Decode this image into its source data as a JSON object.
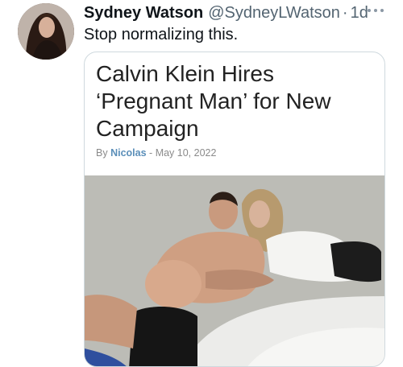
{
  "tweet": {
    "author_name": "Sydney Watson",
    "author_handle": "@SydneyLWatson",
    "separator": "·",
    "time": "1d",
    "text": "Stop normalizing this."
  },
  "card": {
    "headline": "Calvin Klein Hires ‘Pregnant Man’ for New Campaign",
    "byline_prefix": "By",
    "byline_author": "Nicolas",
    "byline_dash": "-",
    "date": "May 10, 2022"
  },
  "icons": {
    "more": "more-icon"
  }
}
